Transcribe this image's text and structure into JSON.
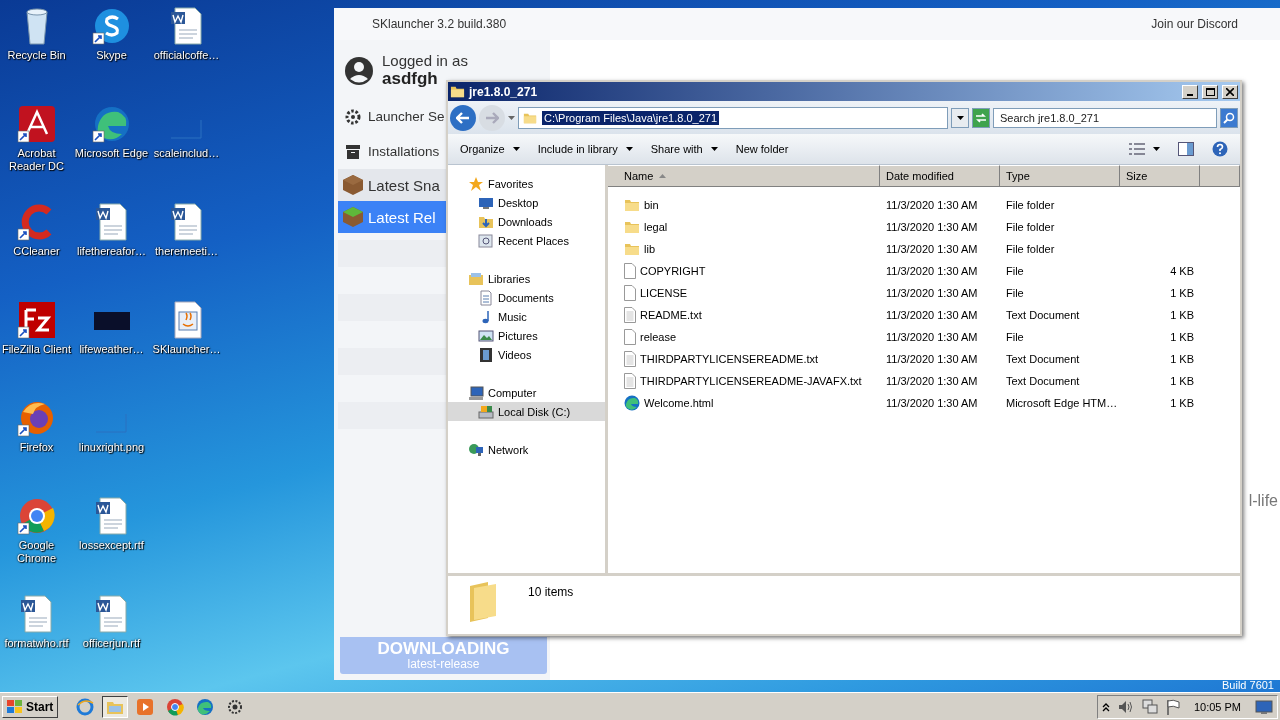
{
  "desktop": {
    "icons": [
      {
        "label": "Recycle Bin",
        "kind": "recycle",
        "shortcut": false
      },
      {
        "label": "Acrobat Reader DC",
        "kind": "acrobat",
        "shortcut": true
      },
      {
        "label": "CCleaner",
        "kind": "ccleaner",
        "shortcut": true
      },
      {
        "label": "FileZilla Client",
        "kind": "filezilla",
        "shortcut": true
      },
      {
        "label": "Firefox",
        "kind": "firefox",
        "shortcut": true
      },
      {
        "label": "Google Chrome",
        "kind": "chrome",
        "shortcut": true
      },
      {
        "label": "formatwho.rtf",
        "kind": "word",
        "shortcut": false
      },
      {
        "label": "Skype",
        "kind": "skype",
        "shortcut": true
      },
      {
        "label": "Microsoft Edge",
        "kind": "edge",
        "shortcut": true
      },
      {
        "label": "lifethereafor…",
        "kind": "word",
        "shortcut": false
      },
      {
        "label": "lifeweather…",
        "kind": "dark",
        "shortcut": false
      },
      {
        "label": "linuxright.png",
        "kind": "blank",
        "shortcut": false
      },
      {
        "label": "lossexcept.rtf",
        "kind": "word",
        "shortcut": false
      },
      {
        "label": "officerjun.rtf",
        "kind": "word",
        "shortcut": false
      },
      {
        "label": "officialcoffe…",
        "kind": "word",
        "shortcut": false
      },
      {
        "label": "scaleinclud…",
        "kind": "blank",
        "shortcut": false
      },
      {
        "label": "theremeeti…",
        "kind": "word",
        "shortcut": false
      },
      {
        "label": "SKlauncher…",
        "kind": "java",
        "shortcut": false
      }
    ],
    "build_label": "Build 7601"
  },
  "launcher": {
    "title": "SKlauncher 3.2 build.380",
    "header_link": "Join our Discord",
    "account": {
      "caption": "Logged in as",
      "username": "asdfgh"
    },
    "menu": [
      {
        "label": "Launcher Se",
        "kind": "settings"
      },
      {
        "label": "Installations",
        "kind": "installations"
      }
    ],
    "profiles": [
      {
        "label": "Latest Sna",
        "selected": false
      },
      {
        "label": "Latest Rel",
        "selected": true
      }
    ],
    "download_button": {
      "label": "DOWNLOADING",
      "sublabel": "latest-release"
    },
    "content_text": "l-life"
  },
  "explorer": {
    "title": "jre1.8.0_271",
    "address": {
      "value": "C:\\Program Files\\Java\\jre1.8.0_271",
      "selected": true
    },
    "search": {
      "placeholder": "Search jre1.8.0_271"
    },
    "toolbar": [
      {
        "label": "Organize",
        "dropdown": true
      },
      {
        "label": "Include in library",
        "dropdown": true
      },
      {
        "label": "Share with",
        "dropdown": true
      },
      {
        "label": "New folder",
        "dropdown": false
      }
    ],
    "nav": [
      {
        "label": "Favorites",
        "kind": "star",
        "selected": false,
        "children": [
          {
            "label": "Desktop",
            "kind": "desktop",
            "selected": false
          },
          {
            "label": "Downloads",
            "kind": "downloads",
            "selected": false
          },
          {
            "label": "Recent Places",
            "kind": "recent",
            "selected": false
          }
        ]
      },
      {
        "label": "Libraries",
        "kind": "libraries",
        "selected": false,
        "children": [
          {
            "label": "Documents",
            "kind": "documents",
            "selected": false
          },
          {
            "label": "Music",
            "kind": "music",
            "selected": false
          },
          {
            "label": "Pictures",
            "kind": "pictures",
            "selected": false
          },
          {
            "label": "Videos",
            "kind": "videos",
            "selected": false
          }
        ]
      },
      {
        "label": "Computer",
        "kind": "computer",
        "selected": false,
        "children": [
          {
            "label": "Local Disk (C:)",
            "kind": "drive",
            "selected": true
          }
        ]
      },
      {
        "label": "Network",
        "kind": "network",
        "selected": false
      }
    ],
    "columns": [
      {
        "label": "Name",
        "sorted": true
      },
      {
        "label": "Date modified",
        "sorted": false
      },
      {
        "label": "Type",
        "sorted": false
      },
      {
        "label": "Size",
        "sorted": false
      }
    ],
    "rows": [
      {
        "name": "bin",
        "kind": "folder",
        "date": "11/3/2020 1:30 AM",
        "type": "File folder"
      },
      {
        "name": "legal",
        "kind": "folder",
        "date": "11/3/2020 1:30 AM",
        "type": "File folder"
      },
      {
        "name": "lib",
        "kind": "folder",
        "date": "11/3/2020 1:30 AM",
        "type": "File folder"
      },
      {
        "name": "COPYRIGHT",
        "kind": "file",
        "date": "11/3/2020 1:30 AM",
        "type": "File",
        "size": "4 KB"
      },
      {
        "name": "LICENSE",
        "kind": "file",
        "date": "11/3/2020 1:30 AM",
        "type": "File",
        "size": "1 KB"
      },
      {
        "name": "README.txt",
        "kind": "text",
        "date": "11/3/2020 1:30 AM",
        "type": "Text Document",
        "size": "1 KB"
      },
      {
        "name": "release",
        "kind": "file",
        "date": "11/3/2020 1:30 AM",
        "type": "File",
        "size": "1 KB"
      },
      {
        "name": "THIRDPARTYLICENSEREADME.txt",
        "kind": "text",
        "date": "11/3/2020 1:30 AM",
        "type": "Text Document",
        "size": "1 KB"
      },
      {
        "name": "THIRDPARTYLICENSEREADME-JAVAFX.txt",
        "kind": "text",
        "date": "11/3/2020 1:30 AM",
        "type": "Text Document",
        "size": "1 KB"
      },
      {
        "name": "Welcome.html",
        "kind": "edge",
        "date": "11/3/2020 1:30 AM",
        "type": "Microsoft Edge HTM…",
        "size": "1 KB"
      }
    ],
    "status": "10 items"
  },
  "taskbar": {
    "start": "Start",
    "apps": [
      {
        "kind": "ie",
        "active": false
      },
      {
        "kind": "explorer",
        "active": true
      },
      {
        "kind": "media",
        "active": false
      },
      {
        "kind": "chrome",
        "active": false
      },
      {
        "kind": "edge",
        "active": false
      },
      {
        "kind": "gear",
        "active": false
      }
    ],
    "clock": "10:05 PM"
  }
}
